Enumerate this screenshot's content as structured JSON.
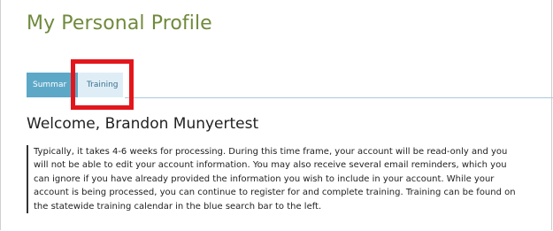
{
  "page": {
    "title": "My Personal Profile"
  },
  "tabs": [
    {
      "label": "Summar",
      "active": true
    },
    {
      "label": "Training",
      "active": false
    }
  ],
  "welcome": {
    "text": "Welcome, Brandon Munyertest"
  },
  "notice": {
    "lines": [
      "Typically, it takes 4-6 weeks for processing. During this time frame, your account will be read-only and you",
      "will not be able to edit your account information. You may also receive several email reminders, which you",
      "can ignore if you have already provided the information you wish to include in your account. While your",
      "account is being processed, you can continue to register for and complete training. Training can be found on",
      "the statewide training calendar in the blue search bar to the left."
    ]
  },
  "colors": {
    "title": "#708a3c",
    "tab_active": "#5ea8c7",
    "tab_inactive": "#dfeef6",
    "highlight": "#e3161c"
  }
}
